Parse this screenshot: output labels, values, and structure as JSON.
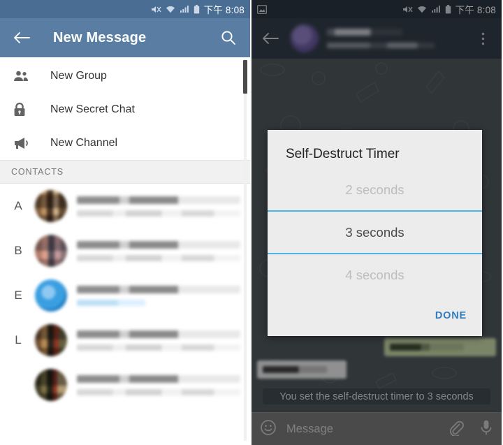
{
  "status_bar": {
    "time": "下午 8:08",
    "icons": [
      "mute-icon",
      "wifi-icon",
      "signal-icon",
      "battery-icon"
    ],
    "right_screenshot_icon": "screenshot-icon"
  },
  "left_screen": {
    "appbar": {
      "back_label": "back-arrow",
      "title": "New Message",
      "search_label": "search"
    },
    "menu": [
      {
        "icon": "group-icon",
        "label": "New Group"
      },
      {
        "icon": "lock-icon",
        "label": "New Secret Chat"
      },
      {
        "icon": "channel-icon",
        "label": "New Channel"
      }
    ],
    "section_header": "CONTACTS",
    "contacts": [
      {
        "letter": "A",
        "name_redacted": true,
        "status_redacted": true,
        "avatar": "photo"
      },
      {
        "letter": "B",
        "name_redacted": true,
        "status_redacted": true,
        "avatar": "photo"
      },
      {
        "letter": "E",
        "name_redacted": true,
        "status_redacted": true,
        "avatar": "photo",
        "status_online": true
      },
      {
        "letter": "L",
        "name_redacted": true,
        "status_redacted": true,
        "avatar": "photo"
      },
      {
        "letter": "",
        "name_redacted": true,
        "status_redacted": true,
        "avatar": "photo"
      }
    ]
  },
  "right_screen": {
    "appbar": {
      "back_label": "back-arrow",
      "name_redacted": true,
      "subtitle_redacted": true,
      "overflow_label": "more-options"
    },
    "messages": {
      "outgoing_redacted": true,
      "incoming_redacted": true,
      "system_message": "You set the self-destruct timer to 3 seconds"
    },
    "composer": {
      "emoji_label": "emoji",
      "placeholder": "Message",
      "attach_label": "attach",
      "mic_label": "voice"
    },
    "dialog": {
      "title": "Self-Destruct Timer",
      "options": [
        {
          "label": "2 seconds",
          "selected": false
        },
        {
          "label": "3 seconds",
          "selected": true
        },
        {
          "label": "4 seconds",
          "selected": false
        }
      ],
      "done_label": "DONE",
      "accent_color": "#4fb3e8",
      "action_color": "#2f7cc0"
    }
  },
  "colors": {
    "left_appbar": "#5a7ea3",
    "left_statusbar": "#4a6d94",
    "right_appbar": "#323c49",
    "chat_background": "#4e565b",
    "composer": "#787878"
  }
}
